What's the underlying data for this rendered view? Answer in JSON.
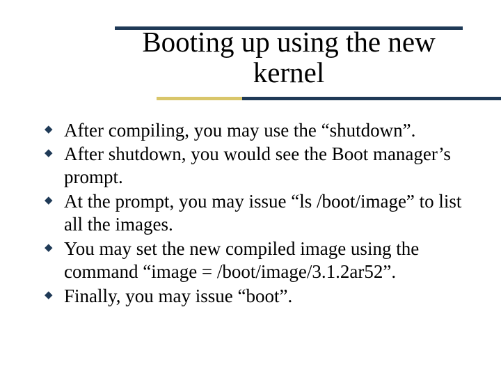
{
  "slide": {
    "title": "Booting up using the new kernel",
    "bullets": [
      "After compiling, you may use the “shutdown”.",
      "After shutdown, you would see the Boot manager’s prompt.",
      "At the prompt, you may issue “ls /boot/image” to list all the images.",
      "You may set the new compiled image using the command “image = /boot/image/3.1.2ar52”.",
      "Finally, you may issue “boot”."
    ]
  }
}
